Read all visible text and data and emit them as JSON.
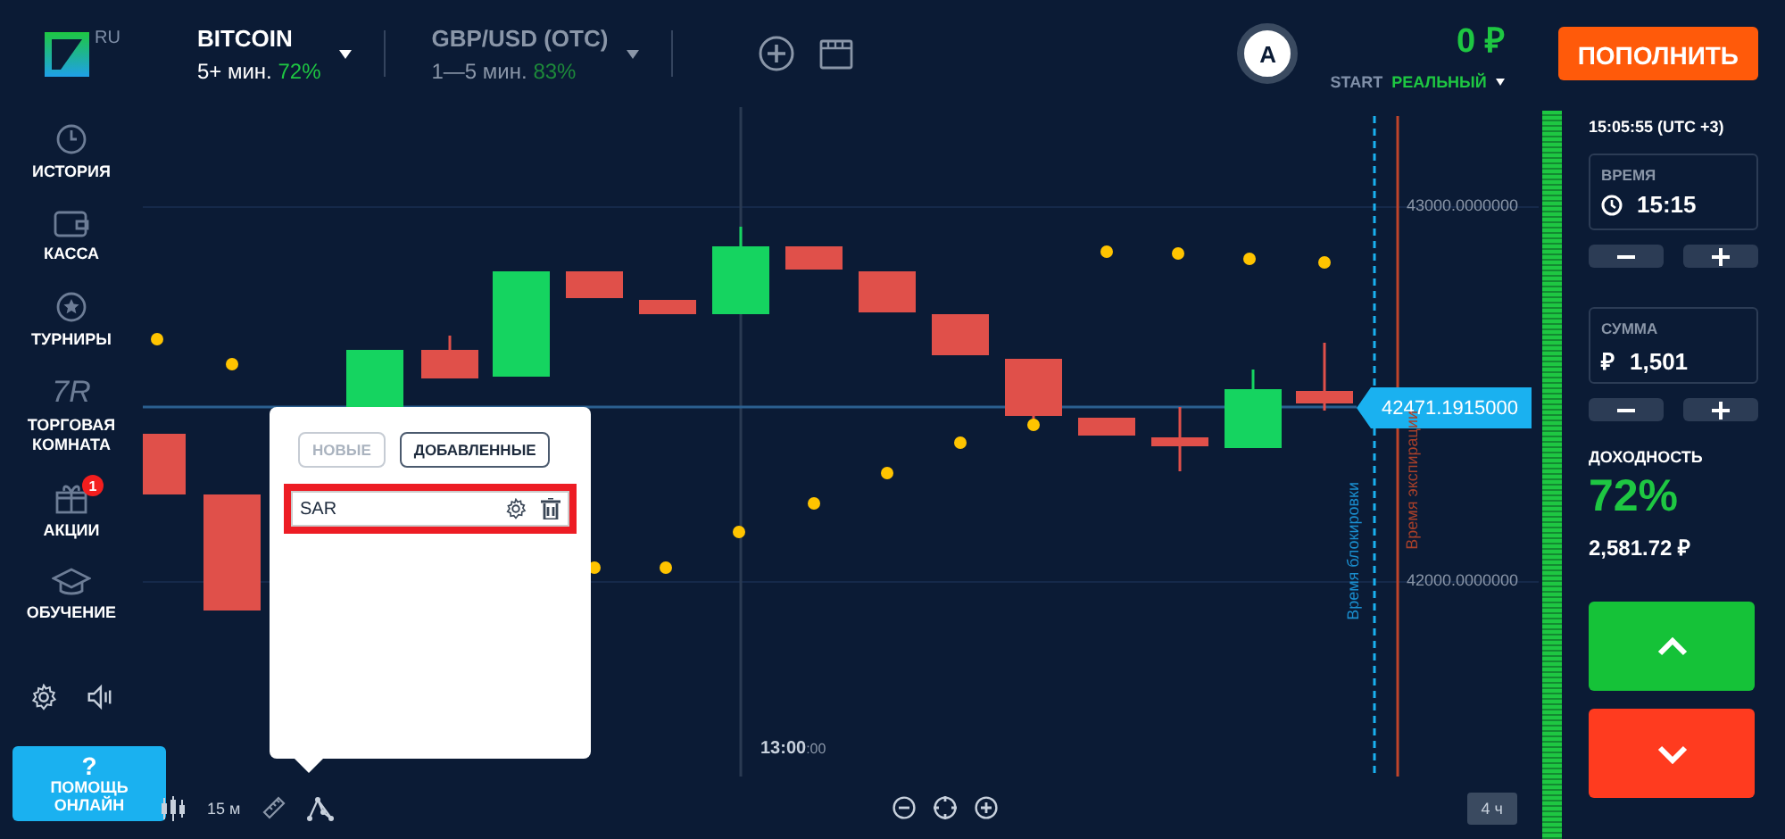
{
  "header": {
    "logo_region": "RU",
    "assets": [
      {
        "name": "BITCOIN",
        "duration": "5+ мин.",
        "payout": "72%",
        "selected": true
      },
      {
        "name": "GBP/USD (OTC)",
        "duration": "1—5 мин.",
        "payout": "83%",
        "selected": false
      }
    ],
    "avatar_letter": "A",
    "balance": "0 ₽",
    "account_type": "START",
    "account_mode": "РЕАЛЬНЫЙ",
    "deposit_button": "ПОПОЛНИТЬ"
  },
  "sidebar": {
    "items": [
      {
        "kind": "history",
        "label": "ИСТОРИЯ"
      },
      {
        "kind": "wallet",
        "label": "КАССА"
      },
      {
        "kind": "star",
        "label": "ТУРНИРЫ"
      },
      {
        "kind": "text",
        "icon_text": "7R",
        "label": "ТОРГОВАЯ КОМНАТА"
      },
      {
        "kind": "gift",
        "label": "АКЦИИ",
        "badge": "1"
      },
      {
        "kind": "cap",
        "label": "ОБУЧЕНИЕ"
      }
    ],
    "help_button": {
      "icon": "?",
      "label": "ПОМОЩЬ ОНЛАЙН"
    }
  },
  "chart": {
    "price_labels": [
      "43000.0000000",
      "42000.0000000"
    ],
    "current_price": "42471.1915000",
    "time_label": "13:00",
    "time_label_seconds": ":00",
    "lock_time_label": "Время блокировки",
    "expiry_label": "Время экспирации"
  },
  "indicator_popup": {
    "tabs": [
      {
        "label": "НОВЫЕ",
        "selected": false
      },
      {
        "label": "ДОБАВЛЕННЫЕ",
        "selected": true
      }
    ],
    "indicators": [
      {
        "name": "SAR",
        "highlighted": true
      }
    ]
  },
  "toolbar": {
    "timeframe": "15 м",
    "zoom_range": "4 ч"
  },
  "trade_panel": {
    "server_time": "15:05:55 (UTC +3)",
    "time_field": {
      "label": "ВРЕМЯ",
      "value": "15:15"
    },
    "amount_field": {
      "label": "СУММА",
      "currency": "₽",
      "value": "1,501"
    },
    "payout_label": "ДОХОДНОСТЬ",
    "payout": "72%",
    "profit": "2,581.72 ₽"
  }
}
